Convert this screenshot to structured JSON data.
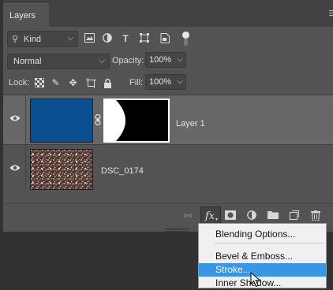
{
  "panel": {
    "tab_label": "Layers"
  },
  "filter": {
    "kind_label": "Kind",
    "icons": [
      "pixel-filter-icon",
      "adjustment-filter-icon",
      "type-filter-icon",
      "shape-filter-icon",
      "smart-object-filter-icon"
    ]
  },
  "blend": {
    "mode": "Normal",
    "opacity_label": "Opacity:",
    "opacity_value": "100%"
  },
  "lock": {
    "label": "Lock:",
    "fill_label": "Fill:",
    "fill_value": "100%",
    "icons": [
      "lock-transparent-pixels-icon",
      "lock-image-pixels-icon",
      "lock-position-icon",
      "prevent-auto-nesting-icon",
      "lock-all-icon"
    ]
  },
  "layers": [
    {
      "name": "Layer 1",
      "selected": true,
      "fill_color": "#0a4f90",
      "mask": true
    },
    {
      "name": "DSC_0174",
      "selected": false,
      "mask": false
    }
  ],
  "bottom_bar": {
    "fx_label": "fx",
    "icons": [
      "link-layers-icon",
      "fx-icon",
      "add-mask-icon",
      "adjustment-layer-icon",
      "new-group-icon",
      "new-layer-icon",
      "delete-layer-icon"
    ]
  },
  "menu": {
    "items": [
      "Blending Options...",
      "Bevel & Emboss...",
      "Stroke...",
      "Inner Shadow..."
    ],
    "highlighted": "Stroke..."
  },
  "colors": {
    "panel_bg": "#535353",
    "selected_layer_bg": "#676767",
    "menu_highlight": "#3797e6",
    "layer_fill": "#0a4f90"
  }
}
